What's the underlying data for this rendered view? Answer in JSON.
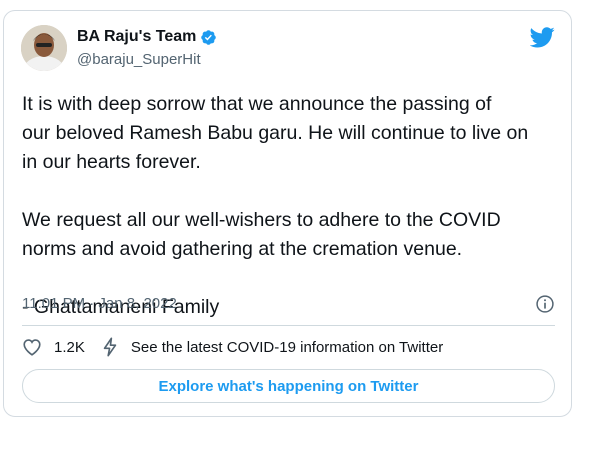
{
  "tweet": {
    "display_name": "BA Raju's Team",
    "handle": "@baraju_SuperHit",
    "text": "It is with deep sorrow that we announce the passing of\nour beloved Ramesh Babu garu. He will continue to live on\nin our hearts forever.\n\nWe request all our well-wishers to adhere to the COVID\nnorms and avoid gathering at the cremation venue.\n\n- Ghattamaneni Family",
    "timestamp": "11:01 PM · Jan 8, 2022",
    "like_count": "1.2K",
    "covid_link": "See the latest COVID-19 information on Twitter",
    "explore_label": "Explore what's happening on Twitter"
  },
  "colors": {
    "twitter_blue": "#1d9bf0",
    "text_primary": "#0f1419",
    "text_secondary": "#536471",
    "border": "#cfd9de"
  },
  "icons": {
    "avatar": "profile-photo",
    "verified": "verified-badge-icon",
    "logo": "twitter-bird-icon",
    "info": "info-icon",
    "like": "heart-icon",
    "covid": "lightning-bolt-icon"
  }
}
